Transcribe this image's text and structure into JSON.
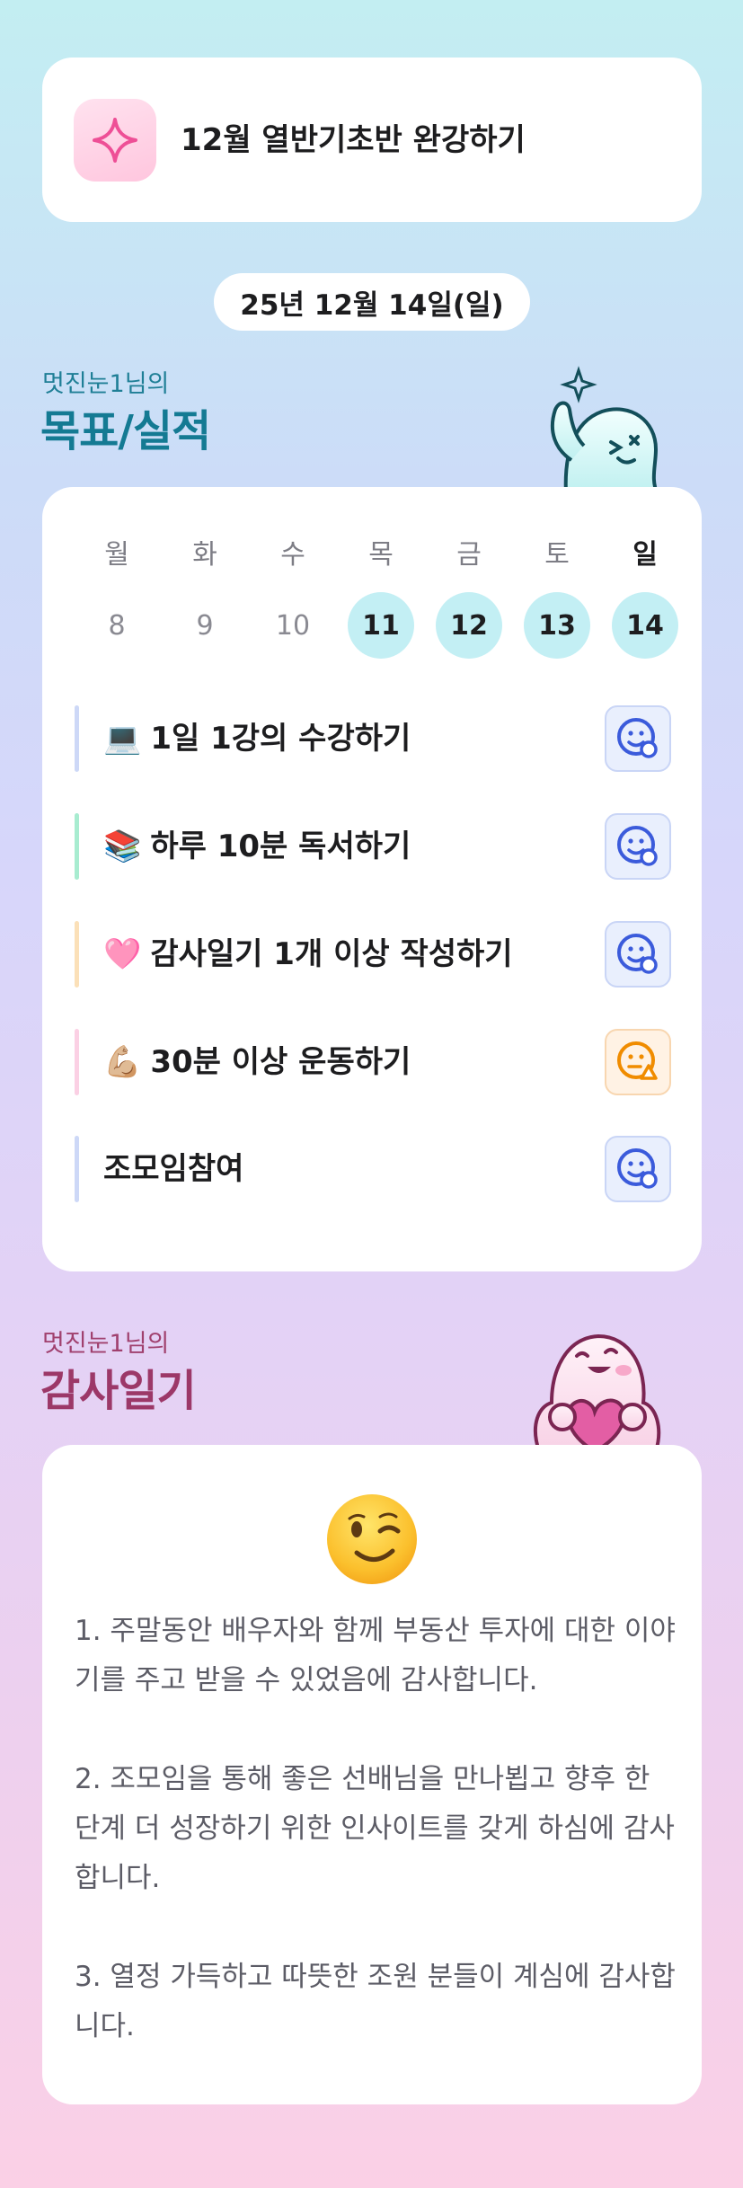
{
  "goal": {
    "icon": "sparkle-icon",
    "title": "12월 열반기초반 완강하기"
  },
  "date": "25년 12월 14일(일)",
  "goals_section": {
    "subtitle": "멋진눈1님의",
    "title": "목표/실적"
  },
  "week": {
    "days": [
      {
        "name": "월",
        "num": "8",
        "active": false,
        "today": false
      },
      {
        "name": "화",
        "num": "9",
        "active": false,
        "today": false
      },
      {
        "name": "수",
        "num": "10",
        "active": false,
        "today": false
      },
      {
        "name": "목",
        "num": "11",
        "active": true,
        "today": false
      },
      {
        "name": "금",
        "num": "12",
        "active": true,
        "today": false
      },
      {
        "name": "토",
        "num": "13",
        "active": true,
        "today": false
      },
      {
        "name": "일",
        "num": "14",
        "active": true,
        "today": true
      }
    ]
  },
  "tasks": [
    {
      "emoji": "💻",
      "label": "1일 1강의 수강하기",
      "bar_color": "#cdd8f7",
      "status": "good",
      "status_icon": "smile-check-icon"
    },
    {
      "emoji": "📚",
      "label": "하루 10분 독서하기",
      "bar_color": "#a8ecd0",
      "status": "good",
      "status_icon": "smile-check-icon"
    },
    {
      "emoji": "🩷",
      "label": "감사일기 1개 이상 작성하기",
      "bar_color": "#fbe0b8",
      "status": "good",
      "status_icon": "smile-check-icon"
    },
    {
      "emoji": "💪🏼",
      "label": "30분 이상 운동하기",
      "bar_color": "#fbd0e4",
      "status": "warn",
      "status_icon": "meh-warning-icon"
    },
    {
      "emoji": "",
      "label": "조모임참여",
      "bar_color": "#cdd8f7",
      "status": "good",
      "status_icon": "smile-check-icon"
    }
  ],
  "thanks_section": {
    "subtitle": "멋진눈1님의",
    "title": "감사일기"
  },
  "thanks": {
    "emoji_icon": "wink-emoji-icon",
    "items": [
      "1. 주말동안 배우자와 함께 부동산 투자에 대한 이야기를 주고 받을 수 있었음에 감사합니다.",
      "2. 조모임을 통해 좋은 선배님을 만나뵙고 향후 한 단계 더 성장하기 위한 인사이트를 갖게 하심에 감사합니다.",
      "3. 열정 가득하고 따뜻한 조원 분들이 계심에 감사합니다."
    ]
  },
  "colors": {
    "goals_accent": "#147a93",
    "thanks_accent": "#9c3868",
    "active_day": "#c3eff4",
    "status_good": "#3b5bdb",
    "status_warn": "#f08c00"
  }
}
